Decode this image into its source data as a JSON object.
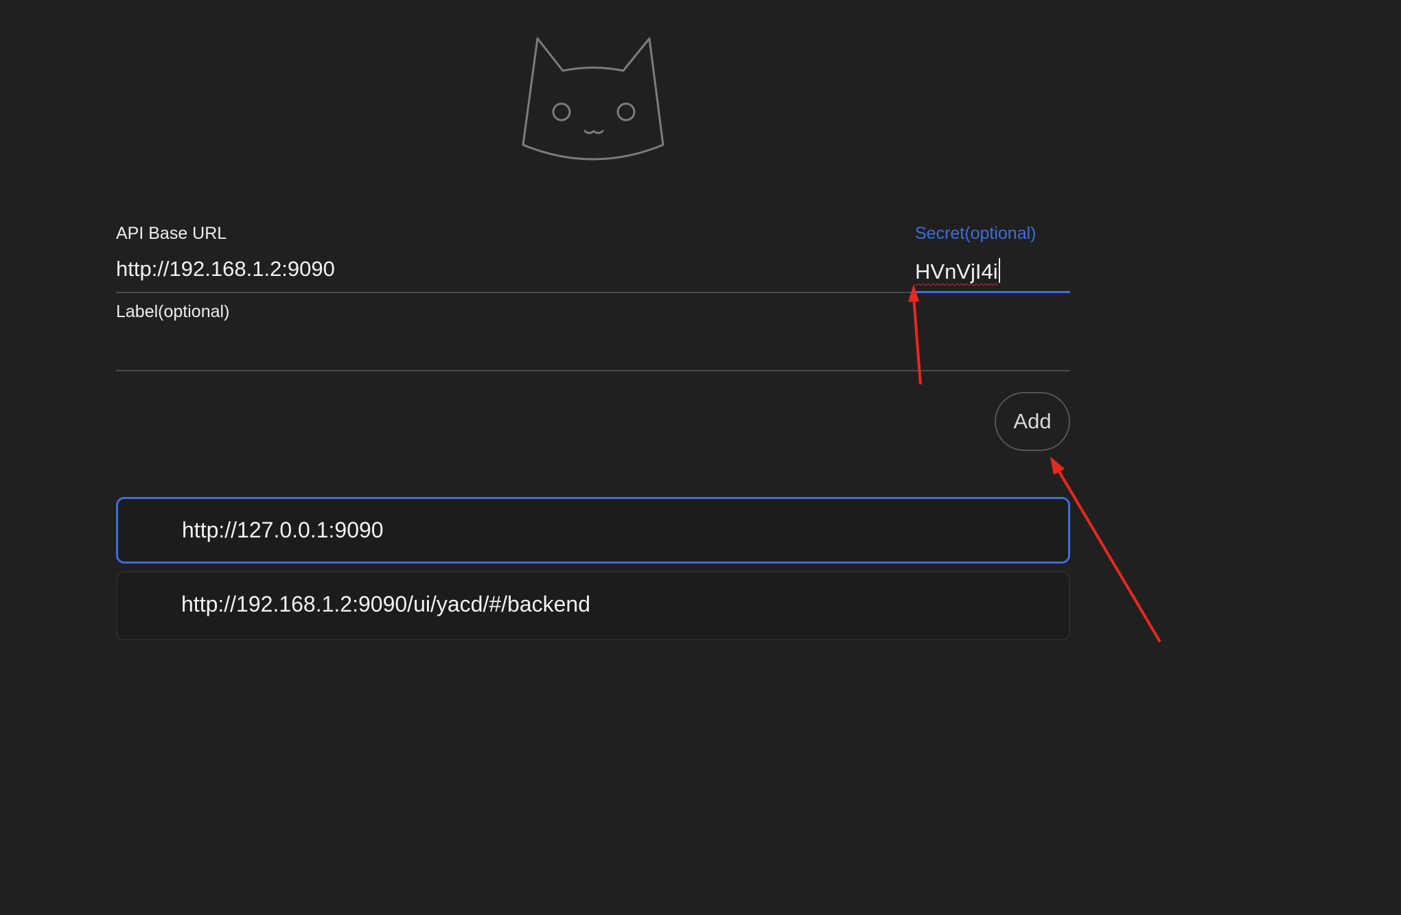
{
  "form": {
    "api_base_url": {
      "label": "API Base URL",
      "value": "http://192.168.1.2:9090"
    },
    "secret": {
      "label": "Secret(optional)",
      "value": "HVnVjI4i"
    },
    "label_field": {
      "label": "Label(optional)",
      "value": ""
    },
    "add_button": "Add"
  },
  "backends": [
    {
      "url": "http://127.0.0.1:9090",
      "selected": true
    },
    {
      "url": "http://192.168.1.2:9090/ui/yacd/#/backend",
      "selected": false
    }
  ],
  "colors": {
    "background": "#202020",
    "accent": "#3b6ee0",
    "annotation_arrow": "#e8281e"
  },
  "icons": {
    "logo": "cat-face-icon"
  }
}
